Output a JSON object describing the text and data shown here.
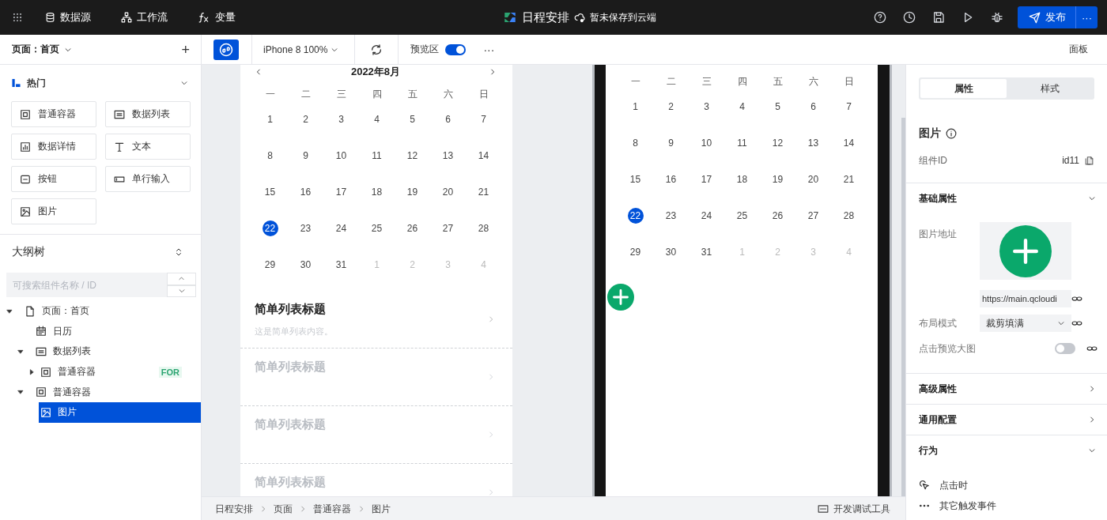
{
  "topbar": {
    "nav": [
      {
        "kind": "datasource",
        "label": "数据源"
      },
      {
        "kind": "workflow",
        "label": "工作流"
      },
      {
        "kind": "variable",
        "label": "变量"
      }
    ],
    "app_title": "日程安排",
    "save_status": "暂未保存到云端",
    "publish": {
      "label": "发布",
      "more": "···"
    }
  },
  "toolbar": {
    "device": "iPhone 8 100%",
    "preview": {
      "label": "预览区",
      "on": true
    },
    "more": "···",
    "panel": "面板"
  },
  "left_panel": {
    "page": "页面：首页",
    "add": "+",
    "group": {
      "title": "热门",
      "expanded": true,
      "components": [
        {
          "kind": "container",
          "label": "普通容器"
        },
        {
          "kind": "list",
          "label": "数据列表"
        },
        {
          "kind": "detail",
          "label": "数据详情"
        },
        {
          "kind": "text",
          "label": "文本"
        },
        {
          "kind": "button",
          "label": "按钮"
        },
        {
          "kind": "input",
          "label": "单行输入"
        },
        {
          "kind": "image",
          "label": "图片"
        }
      ]
    },
    "outline": {
      "title": "大纲树",
      "search_placeholder": "可搜索组件名称 / ID",
      "tree": [
        {
          "kind": "page",
          "label": "页面：首页",
          "expanded": true,
          "selected": false,
          "children": [
            {
              "kind": "calendar",
              "label": "日历",
              "selected": false
            },
            {
              "kind": "list",
              "label": "数据列表",
              "expanded": true,
              "selected": false,
              "children": [
                {
                  "kind": "container",
                  "label": "普通容器",
                  "expanded": false,
                  "selected": false,
                  "badge": "FOR"
                }
              ]
            },
            {
              "kind": "container",
              "label": "普通容器",
              "expanded": true,
              "selected": false,
              "children": [
                {
                  "kind": "image",
                  "label": "图片",
                  "selected": true
                }
              ]
            }
          ]
        }
      ]
    }
  },
  "preview_left": {
    "calendar": {
      "title": "2022年8月",
      "weekdays": [
        "一",
        "二",
        "三",
        "四",
        "五",
        "六",
        "日"
      ],
      "weeks": [
        {
          "days": [
            {
              "d": "1",
              "selected": false,
              "muted": false
            },
            {
              "d": "2",
              "selected": false,
              "muted": false
            },
            {
              "d": "3",
              "selected": false,
              "muted": false
            },
            {
              "d": "4",
              "selected": false,
              "muted": false
            },
            {
              "d": "5",
              "selected": false,
              "muted": false
            },
            {
              "d": "6",
              "selected": false,
              "muted": false
            },
            {
              "d": "7",
              "selected": false,
              "muted": false
            }
          ]
        },
        {
          "days": [
            {
              "d": "8",
              "selected": false,
              "muted": false
            },
            {
              "d": "9",
              "selected": false,
              "muted": false
            },
            {
              "d": "10",
              "selected": false,
              "muted": false
            },
            {
              "d": "11",
              "selected": false,
              "muted": false
            },
            {
              "d": "12",
              "selected": false,
              "muted": false
            },
            {
              "d": "13",
              "selected": false,
              "muted": false
            },
            {
              "d": "14",
              "selected": false,
              "muted": false
            }
          ]
        },
        {
          "days": [
            {
              "d": "15",
              "selected": false,
              "muted": false
            },
            {
              "d": "16",
              "selected": false,
              "muted": false
            },
            {
              "d": "17",
              "selected": false,
              "muted": false
            },
            {
              "d": "18",
              "selected": false,
              "muted": false
            },
            {
              "d": "19",
              "selected": false,
              "muted": false
            },
            {
              "d": "20",
              "selected": false,
              "muted": false
            },
            {
              "d": "21",
              "selected": false,
              "muted": false
            }
          ]
        },
        {
          "days": [
            {
              "d": "22",
              "selected": true,
              "muted": false
            },
            {
              "d": "23",
              "selected": false,
              "muted": false
            },
            {
              "d": "24",
              "selected": false,
              "muted": false
            },
            {
              "d": "25",
              "selected": false,
              "muted": false
            },
            {
              "d": "26",
              "selected": false,
              "muted": false
            },
            {
              "d": "27",
              "selected": false,
              "muted": false
            },
            {
              "d": "28",
              "selected": false,
              "muted": false
            }
          ]
        },
        {
          "days": [
            {
              "d": "29",
              "selected": false,
              "muted": false
            },
            {
              "d": "30",
              "selected": false,
              "muted": false
            },
            {
              "d": "31",
              "selected": false,
              "muted": false
            },
            {
              "d": "1",
              "selected": false,
              "muted": true
            },
            {
              "d": "2",
              "selected": false,
              "muted": true
            },
            {
              "d": "3",
              "selected": false,
              "muted": true
            },
            {
              "d": "4",
              "selected": false,
              "muted": true
            }
          ]
        }
      ]
    },
    "list": [
      {
        "title": "简单列表标题",
        "subtitle": "这是简单列表内容。",
        "dimmed": false
      },
      {
        "title": "简单列表标题",
        "dimmed": true
      },
      {
        "title": "简单列表标题",
        "dimmed": true
      },
      {
        "title": "简单列表标题",
        "dimmed": true
      }
    ]
  },
  "preview_right": {
    "calendar": {
      "weekdays": [
        "一",
        "二",
        "三",
        "四",
        "五",
        "六",
        "日"
      ],
      "weeks": [
        {
          "days": [
            {
              "d": "1",
              "selected": false,
              "muted": false
            },
            {
              "d": "2",
              "selected": false,
              "muted": false
            },
            {
              "d": "3",
              "selected": false,
              "muted": false
            },
            {
              "d": "4",
              "selected": false,
              "muted": false
            },
            {
              "d": "5",
              "selected": false,
              "muted": false
            },
            {
              "d": "6",
              "selected": false,
              "muted": false
            },
            {
              "d": "7",
              "selected": false,
              "muted": false
            }
          ]
        },
        {
          "days": [
            {
              "d": "8",
              "selected": false,
              "muted": false
            },
            {
              "d": "9",
              "selected": false,
              "muted": false
            },
            {
              "d": "10",
              "selected": false,
              "muted": false
            },
            {
              "d": "11",
              "selected": false,
              "muted": false
            },
            {
              "d": "12",
              "selected": false,
              "muted": false
            },
            {
              "d": "13",
              "selected": false,
              "muted": false
            },
            {
              "d": "14",
              "selected": false,
              "muted": false
            }
          ]
        },
        {
          "days": [
            {
              "d": "15",
              "selected": false,
              "muted": false
            },
            {
              "d": "16",
              "selected": false,
              "muted": false
            },
            {
              "d": "17",
              "selected": false,
              "muted": false
            },
            {
              "d": "18",
              "selected": false,
              "muted": false
            },
            {
              "d": "19",
              "selected": false,
              "muted": false
            },
            {
              "d": "20",
              "selected": false,
              "muted": false
            },
            {
              "d": "21",
              "selected": false,
              "muted": false
            }
          ]
        },
        {
          "days": [
            {
              "d": "22",
              "selected": true,
              "muted": false
            },
            {
              "d": "23",
              "selected": false,
              "muted": false
            },
            {
              "d": "24",
              "selected": false,
              "muted": false
            },
            {
              "d": "25",
              "selected": false,
              "muted": false
            },
            {
              "d": "26",
              "selected": false,
              "muted": false
            },
            {
              "d": "27",
              "selected": false,
              "muted": false
            },
            {
              "d": "28",
              "selected": false,
              "muted": false
            }
          ]
        },
        {
          "days": [
            {
              "d": "29",
              "selected": false,
              "muted": false
            },
            {
              "d": "30",
              "selected": false,
              "muted": false
            },
            {
              "d": "31",
              "selected": false,
              "muted": false
            },
            {
              "d": "1",
              "selected": false,
              "muted": true
            },
            {
              "d": "2",
              "selected": false,
              "muted": true
            },
            {
              "d": "3",
              "selected": false,
              "muted": true
            },
            {
              "d": "4",
              "selected": false,
              "muted": true
            }
          ]
        }
      ]
    }
  },
  "breadcrumb": {
    "items": [
      "日程安排",
      "页面",
      "普通容器",
      "图片"
    ],
    "dev_tools": "开发调试工具"
  },
  "right_panel": {
    "tabs": [
      {
        "label": "属性",
        "selected": true
      },
      {
        "label": "样式",
        "selected": false
      }
    ],
    "title": "图片",
    "component_id": {
      "label": "组件ID",
      "value": "id11"
    },
    "sections": [
      {
        "kind": "basic",
        "title": "基础属性",
        "expanded": true,
        "fields": [
          {
            "kind": "image",
            "label": "图片地址",
            "value": "https://main.qcloudi"
          },
          {
            "kind": "select",
            "label": "布局模式",
            "value": "裁剪填满"
          },
          {
            "kind": "toggle",
            "label": "点击预览大图",
            "on": false
          }
        ]
      },
      {
        "kind": "plain",
        "title": "高级属性",
        "expanded": false
      },
      {
        "kind": "plain",
        "title": "通用配置",
        "expanded": false
      },
      {
        "kind": "behavior",
        "title": "行为",
        "expanded": true,
        "events": [
          {
            "kind": "click",
            "label": "点击时"
          },
          {
            "kind": "other",
            "label": "其它触发事件"
          }
        ]
      }
    ]
  }
}
